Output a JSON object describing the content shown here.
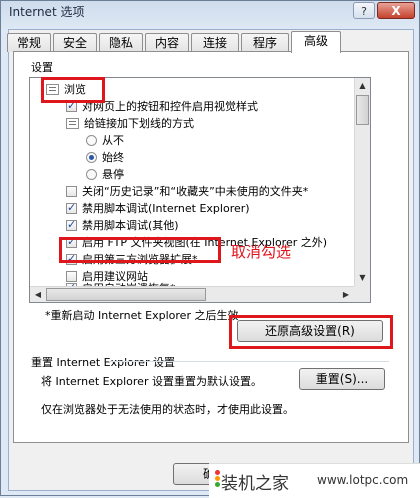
{
  "window": {
    "title": "Internet 选项",
    "help_label": "?",
    "close_label": "X"
  },
  "tabs": [
    {
      "label": "常规"
    },
    {
      "label": "安全"
    },
    {
      "label": "隐私"
    },
    {
      "label": "内容"
    },
    {
      "label": "连接"
    },
    {
      "label": "程序"
    },
    {
      "label": "高级"
    }
  ],
  "settings": {
    "group_label": "设置",
    "items": [
      {
        "type": "folder",
        "label": "浏览"
      },
      {
        "type": "checkbox",
        "checked": true,
        "label": "对网页上的按钮和控件启用视觉样式"
      },
      {
        "type": "folder",
        "label": "给链接加下划线的方式"
      },
      {
        "type": "radio",
        "checked": false,
        "label": "从不"
      },
      {
        "type": "radio",
        "checked": true,
        "label": "始终"
      },
      {
        "type": "radio",
        "checked": false,
        "label": "悬停"
      },
      {
        "type": "checkbox",
        "checked": false,
        "label": "关闭“历史记录”和“收藏夹”中未使用的文件夹*"
      },
      {
        "type": "checkbox",
        "checked": true,
        "label": "禁用脚本调试(Internet Explorer)"
      },
      {
        "type": "checkbox",
        "checked": true,
        "label": "禁用脚本调试(其他)"
      },
      {
        "type": "checkbox",
        "checked": true,
        "label": "启用 FTP 文件夹视图(在 Internet Explorer 之外)"
      },
      {
        "type": "checkbox",
        "checked": true,
        "label": "启用第三方浏览器扩展*"
      },
      {
        "type": "checkbox",
        "checked": false,
        "label": "启用建议网站"
      },
      {
        "type": "checkbox",
        "checked": true,
        "label": "启用自动崩溃恢复*"
      }
    ]
  },
  "annotation": {
    "text": "取消勾选",
    "color": "#e0161d"
  },
  "restart_note": "*重新启动 Internet Explorer 之后生效",
  "restore_advanced_button": "还原高级设置(R)",
  "reset": {
    "heading": "重置 Internet Explorer 设置",
    "description": "将 Internet Explorer 设置重置为默认设置。",
    "button": "重置(S)...",
    "note": "仅在浏览器处于无法使用的状态时，才使用此设置。"
  },
  "footer": {
    "ok_button": "确"
  },
  "watermark": {
    "brand": "装机之家",
    "url": "www.lotpc.com"
  }
}
